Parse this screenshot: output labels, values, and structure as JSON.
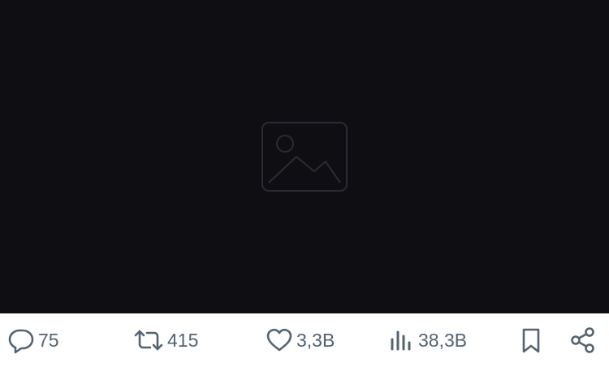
{
  "media": {
    "alt": "Photo",
    "background": "#0f0f13"
  },
  "actions": {
    "reply": {
      "icon": "reply-icon",
      "count": "75"
    },
    "repost": {
      "icon": "repost-icon",
      "count": "415"
    },
    "like": {
      "icon": "heart-icon",
      "count": "3,3B"
    },
    "views": {
      "icon": "views-chart-icon",
      "count": "38,3B"
    },
    "bookmark": {
      "icon": "bookmark-icon"
    },
    "share": {
      "icon": "share-icon"
    }
  },
  "colors": {
    "icon": "#536471",
    "background": "#ffffff"
  }
}
